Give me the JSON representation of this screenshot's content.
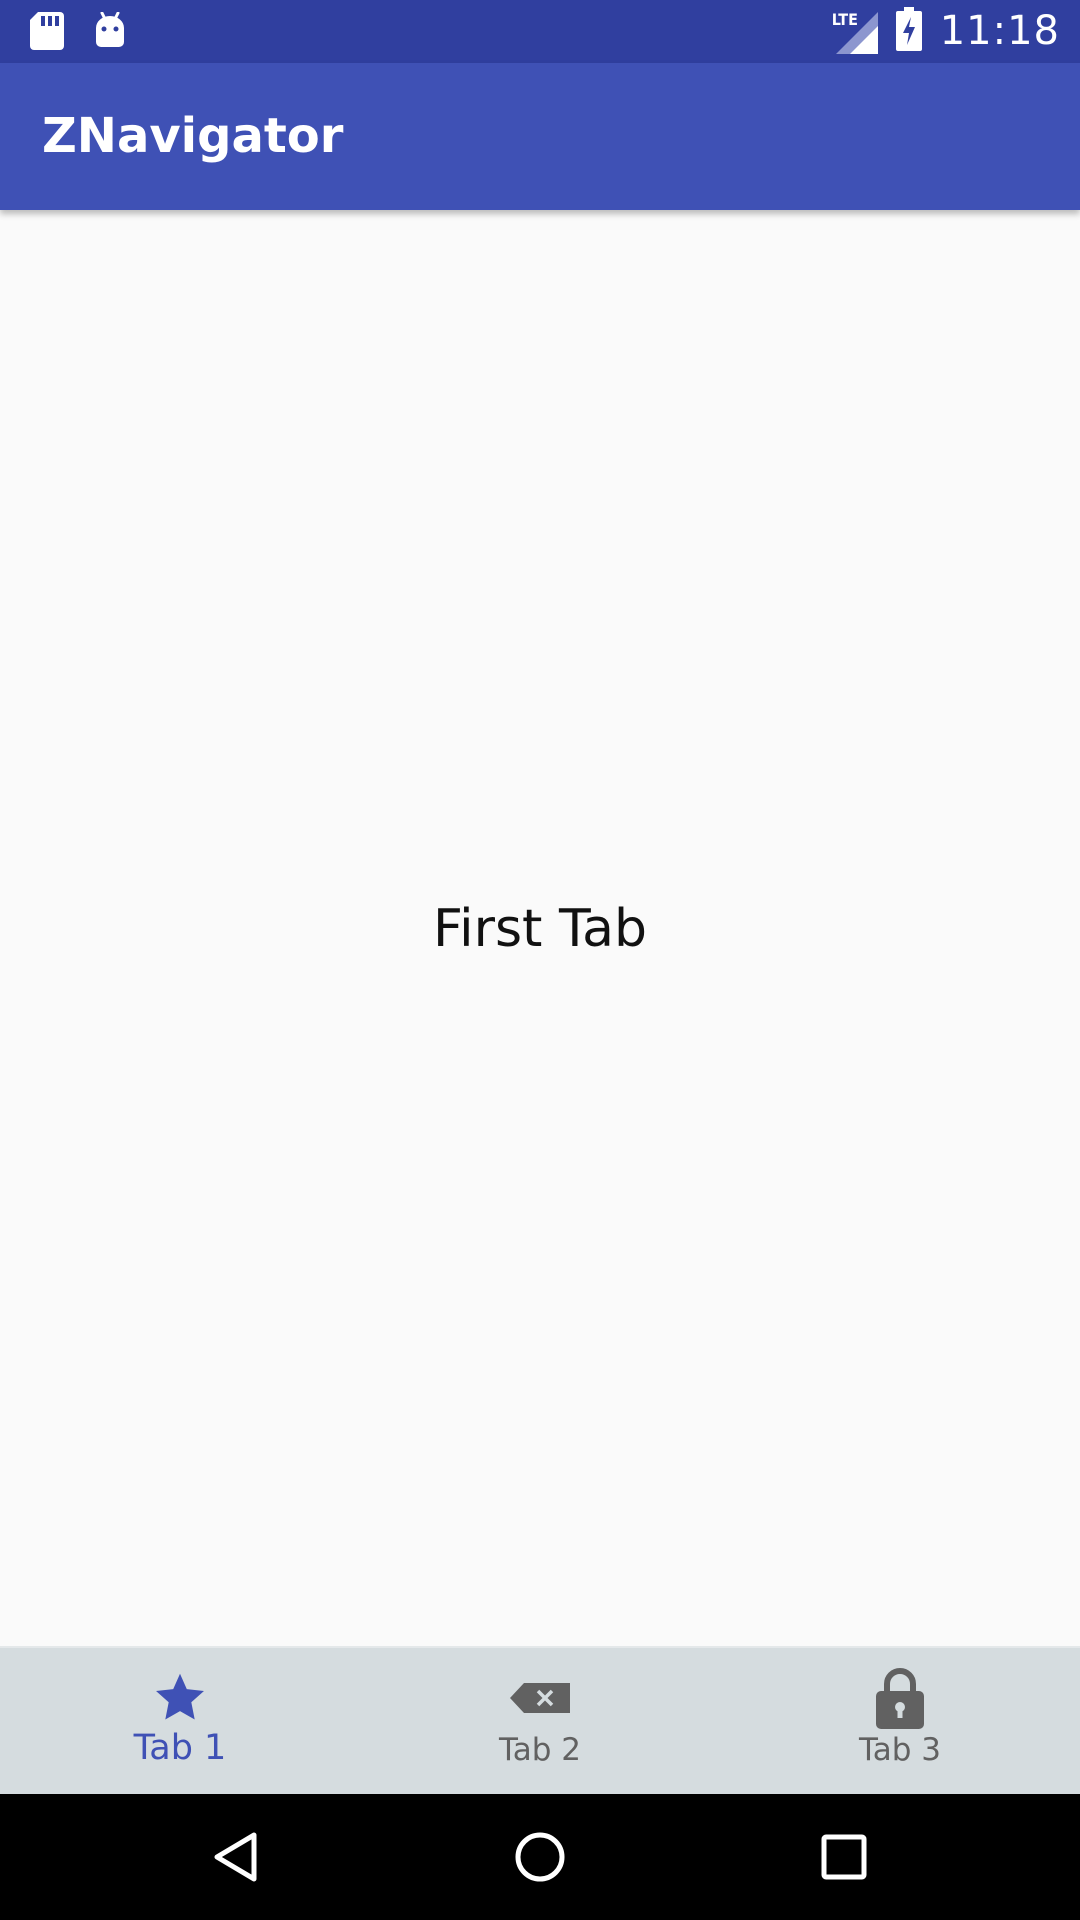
{
  "status_bar": {
    "time": "11:18",
    "network": "LTE",
    "icons": [
      "sd-card-icon",
      "android-icon",
      "lte-signal-icon",
      "battery-charging-icon"
    ]
  },
  "app_bar": {
    "title": "ZNavigator"
  },
  "content": {
    "text": "First Tab"
  },
  "bottom_nav": {
    "items": [
      {
        "label": "Tab 1",
        "icon": "star-icon",
        "active": true
      },
      {
        "label": "Tab 2",
        "icon": "backspace-icon",
        "active": false
      },
      {
        "label": "Tab 3",
        "icon": "lock-icon",
        "active": false
      }
    ]
  },
  "system_nav": {
    "buttons": [
      "back-icon",
      "home-icon",
      "recents-icon"
    ]
  },
  "colors": {
    "status_bar": "#303f9f",
    "primary": "#3f51b5",
    "bottom_nav_bg": "#d5dcdf",
    "inactive_icon": "#616161",
    "background": "#fafafa"
  }
}
